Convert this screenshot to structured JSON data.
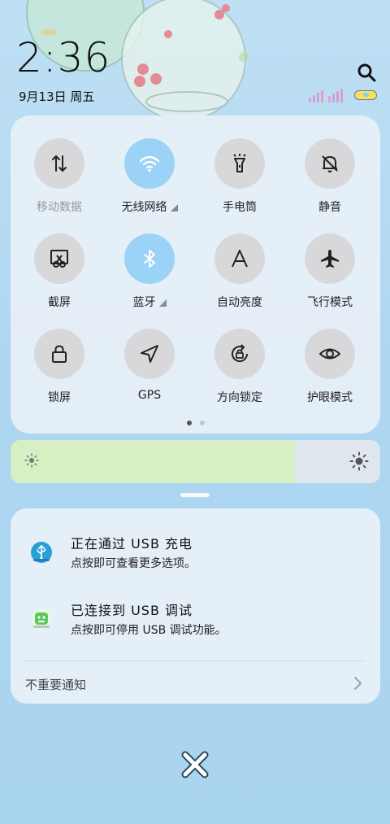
{
  "status": {
    "time": "2:36",
    "date": "9月13日 周五"
  },
  "quick_settings": {
    "tiles": [
      {
        "label": "移动数据",
        "icon": "mobile-data-icon",
        "state": "disabled"
      },
      {
        "label": "无线网络",
        "icon": "wifi-icon",
        "state": "on"
      },
      {
        "label": "手电筒",
        "icon": "flashlight-icon",
        "state": "off"
      },
      {
        "label": "静音",
        "icon": "mute-bell-icon",
        "state": "off"
      },
      {
        "label": "截屏",
        "icon": "screenshot-icon",
        "state": "off"
      },
      {
        "label": "蓝牙",
        "icon": "bluetooth-icon",
        "state": "on"
      },
      {
        "label": "自动亮度",
        "icon": "auto-brightness-icon",
        "state": "off"
      },
      {
        "label": "飞行模式",
        "icon": "airplane-icon",
        "state": "off"
      },
      {
        "label": "锁屏",
        "icon": "lock-icon",
        "state": "off"
      },
      {
        "label": "GPS",
        "icon": "location-arrow-icon",
        "state": "off"
      },
      {
        "label": "方向锁定",
        "icon": "rotation-lock-icon",
        "state": "off"
      },
      {
        "label": "护眼模式",
        "icon": "eye-icon",
        "state": "off"
      }
    ],
    "page_count": 2,
    "active_page": 0
  },
  "brightness": {
    "level": 0.77,
    "fill_color": "#d6f0c4",
    "track_color": "#dfe6ed"
  },
  "notifications": {
    "items": [
      {
        "title": "正在通过 USB 充电",
        "text": "点按即可查看更多选项。",
        "icon": "usb-icon",
        "color": "#2a9fd6"
      },
      {
        "title": "已连接到 USB 调试",
        "text": "点按即可停用 USB 调试功能。",
        "icon": "android-debug-icon",
        "color": "#5dc85a"
      }
    ],
    "footer": "不重要通知"
  },
  "accent": "#9bd3f7"
}
